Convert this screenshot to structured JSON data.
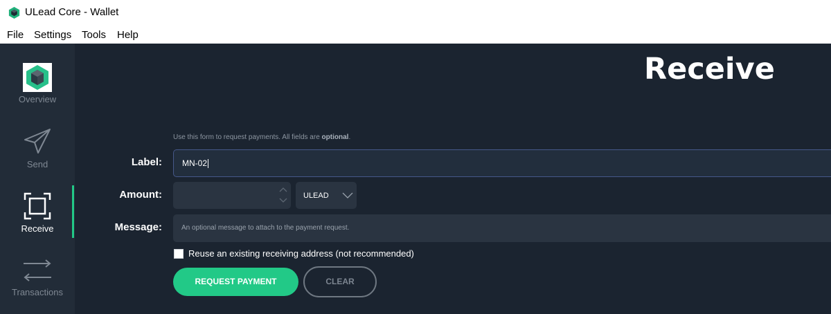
{
  "window": {
    "title": "ULead Core - Wallet",
    "icon": "ulead-logo-icon"
  },
  "menu": {
    "items": [
      "File",
      "Settings",
      "Tools",
      "Help"
    ]
  },
  "sidebar": {
    "items": [
      {
        "label": "Overview",
        "icon": "ulead-logo-icon",
        "active": false
      },
      {
        "label": "Send",
        "icon": "paper-plane-icon",
        "active": false
      },
      {
        "label": "Receive",
        "icon": "qr-frame-icon",
        "active": true
      },
      {
        "label": "Transactions",
        "icon": "swap-arrows-icon",
        "active": false
      }
    ]
  },
  "page": {
    "title": "Receive",
    "hint_prefix": "Use this form to request payments. All fields are ",
    "hint_bold": "optional",
    "hint_suffix": "."
  },
  "form": {
    "label_label": "Label:",
    "label_value": "MN-02",
    "amount_label": "Amount:",
    "amount_value": "",
    "unit_value": "ULEAD",
    "message_label": "Message:",
    "message_placeholder": "An optional message to attach to the payment request.",
    "reuse_label": "Reuse an existing receiving address (not recommended)",
    "reuse_checked": false
  },
  "buttons": {
    "request": "REQUEST PAYMENT",
    "clear": "CLEAR"
  },
  "colors": {
    "accent": "#22c987",
    "background": "#1b2430",
    "sidebar": "#222c38"
  }
}
